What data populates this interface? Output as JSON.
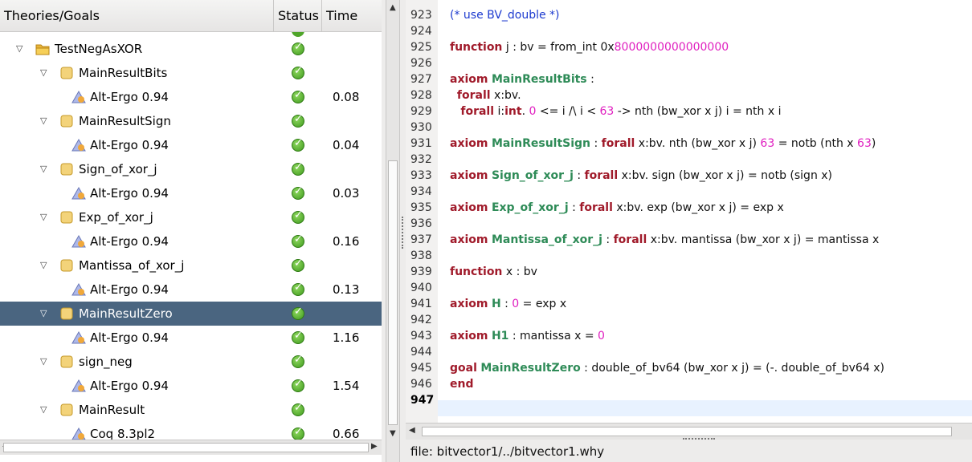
{
  "tree": {
    "columns": [
      "Theories/Goals",
      "Status",
      "Time"
    ],
    "rows": [
      {
        "label": "TestNegAsXOR",
        "kind": "theory",
        "level": 0,
        "time": ""
      },
      {
        "label": "MainResultBits",
        "kind": "goal",
        "level": 1,
        "time": ""
      },
      {
        "label": "Alt-Ergo 0.94",
        "kind": "prover",
        "level": 2,
        "time": "0.08"
      },
      {
        "label": "MainResultSign",
        "kind": "goal",
        "level": 1,
        "time": ""
      },
      {
        "label": "Alt-Ergo 0.94",
        "kind": "prover",
        "level": 2,
        "time": "0.04"
      },
      {
        "label": "Sign_of_xor_j",
        "kind": "goal",
        "level": 1,
        "time": ""
      },
      {
        "label": "Alt-Ergo 0.94",
        "kind": "prover",
        "level": 2,
        "time": "0.03"
      },
      {
        "label": "Exp_of_xor_j",
        "kind": "goal",
        "level": 1,
        "time": ""
      },
      {
        "label": "Alt-Ergo 0.94",
        "kind": "prover",
        "level": 2,
        "time": "0.16"
      },
      {
        "label": "Mantissa_of_xor_j",
        "kind": "goal",
        "level": 1,
        "time": ""
      },
      {
        "label": "Alt-Ergo 0.94",
        "kind": "prover",
        "level": 2,
        "time": "0.13"
      },
      {
        "label": "MainResultZero",
        "kind": "goal",
        "level": 1,
        "time": "",
        "selected": true
      },
      {
        "label": "Alt-Ergo 0.94",
        "kind": "prover",
        "level": 2,
        "time": "1.16"
      },
      {
        "label": "sign_neg",
        "kind": "goal",
        "level": 1,
        "time": ""
      },
      {
        "label": "Alt-Ergo 0.94",
        "kind": "prover",
        "level": 2,
        "time": "1.54"
      },
      {
        "label": "MainResult",
        "kind": "goal",
        "level": 1,
        "time": ""
      },
      {
        "label": "Coq 8.3pl2",
        "kind": "prover",
        "level": 2,
        "time": "0.66"
      }
    ]
  },
  "editor": {
    "lines": [
      {
        "n": "923",
        "seg": [
          [
            "cm",
            "(* use BV_double *)"
          ]
        ]
      },
      {
        "n": "924",
        "seg": []
      },
      {
        "n": "925",
        "seg": [
          [
            "kw",
            "function"
          ],
          [
            "",
            " j : bv = from_int 0x"
          ],
          [
            "mg",
            "8000000000000000"
          ]
        ]
      },
      {
        "n": "926",
        "seg": []
      },
      {
        "n": "927",
        "seg": [
          [
            "kw",
            "axiom"
          ],
          [
            "",
            " "
          ],
          [
            "nm",
            "MainResultBits"
          ],
          [
            "",
            " :"
          ]
        ]
      },
      {
        "n": "928",
        "seg": [
          [
            "",
            "  "
          ],
          [
            "kw",
            "forall"
          ],
          [
            "",
            " x:bv."
          ]
        ]
      },
      {
        "n": "929",
        "seg": [
          [
            "",
            "   "
          ],
          [
            "kw",
            "forall"
          ],
          [
            "",
            " i:"
          ],
          [
            "kw",
            "int"
          ],
          [
            "",
            ". "
          ],
          [
            "mg",
            "0"
          ],
          [
            "",
            " <= i /\\ i < "
          ],
          [
            "mg",
            "63"
          ],
          [
            "",
            " -> nth (bw_xor x j) i = nth x i"
          ]
        ]
      },
      {
        "n": "930",
        "seg": []
      },
      {
        "n": "931",
        "seg": [
          [
            "kw",
            "axiom"
          ],
          [
            "",
            " "
          ],
          [
            "nm",
            "MainResultSign"
          ],
          [
            "",
            " : "
          ],
          [
            "kw",
            "forall"
          ],
          [
            "",
            " x:bv. nth (bw_xor x j) "
          ],
          [
            "mg",
            "63"
          ],
          [
            "",
            " = notb (nth x "
          ],
          [
            "mg",
            "63"
          ],
          [
            "",
            ")"
          ]
        ]
      },
      {
        "n": "932",
        "seg": []
      },
      {
        "n": "933",
        "seg": [
          [
            "kw",
            "axiom"
          ],
          [
            "",
            " "
          ],
          [
            "nm",
            "Sign_of_xor_j"
          ],
          [
            "",
            " : "
          ],
          [
            "kw",
            "forall"
          ],
          [
            "",
            " x:bv. sign (bw_xor x j) = notb (sign x)"
          ]
        ]
      },
      {
        "n": "934",
        "seg": []
      },
      {
        "n": "935",
        "seg": [
          [
            "kw",
            "axiom"
          ],
          [
            "",
            " "
          ],
          [
            "nm",
            "Exp_of_xor_j"
          ],
          [
            "",
            " : "
          ],
          [
            "kw",
            "forall"
          ],
          [
            "",
            " x:bv. exp (bw_xor x j) = exp x"
          ]
        ]
      },
      {
        "n": "936",
        "seg": []
      },
      {
        "n": "937",
        "seg": [
          [
            "kw",
            "axiom"
          ],
          [
            "",
            " "
          ],
          [
            "nm",
            "Mantissa_of_xor_j"
          ],
          [
            "",
            " : "
          ],
          [
            "kw",
            "forall"
          ],
          [
            "",
            " x:bv. mantissa (bw_xor x j) = mantissa x"
          ]
        ]
      },
      {
        "n": "938",
        "seg": []
      },
      {
        "n": "939",
        "seg": [
          [
            "kw",
            "function"
          ],
          [
            "",
            " x : bv"
          ]
        ]
      },
      {
        "n": "940",
        "seg": []
      },
      {
        "n": "941",
        "seg": [
          [
            "kw",
            "axiom"
          ],
          [
            "",
            " "
          ],
          [
            "nm",
            "H"
          ],
          [
            "",
            " : "
          ],
          [
            "mg",
            "0"
          ],
          [
            "",
            " = exp x"
          ]
        ]
      },
      {
        "n": "942",
        "seg": []
      },
      {
        "n": "943",
        "seg": [
          [
            "kw",
            "axiom"
          ],
          [
            "",
            " "
          ],
          [
            "nm",
            "H1"
          ],
          [
            "",
            " : mantissa x = "
          ],
          [
            "mg",
            "0"
          ]
        ]
      },
      {
        "n": "944",
        "seg": []
      },
      {
        "n": "945",
        "seg": [
          [
            "kw",
            "goal"
          ],
          [
            "",
            " "
          ],
          [
            "nm",
            "MainResultZero"
          ],
          [
            "",
            " : double_of_bv64 (bw_xor x j) = (-. double_of_bv64 x)"
          ]
        ]
      },
      {
        "n": "946",
        "seg": [
          [
            "kw",
            "end"
          ]
        ]
      },
      {
        "n": "947",
        "seg": [],
        "current": true
      }
    ]
  },
  "status_bar": {
    "text": "file: bitvector1/../bitvector1.why"
  }
}
